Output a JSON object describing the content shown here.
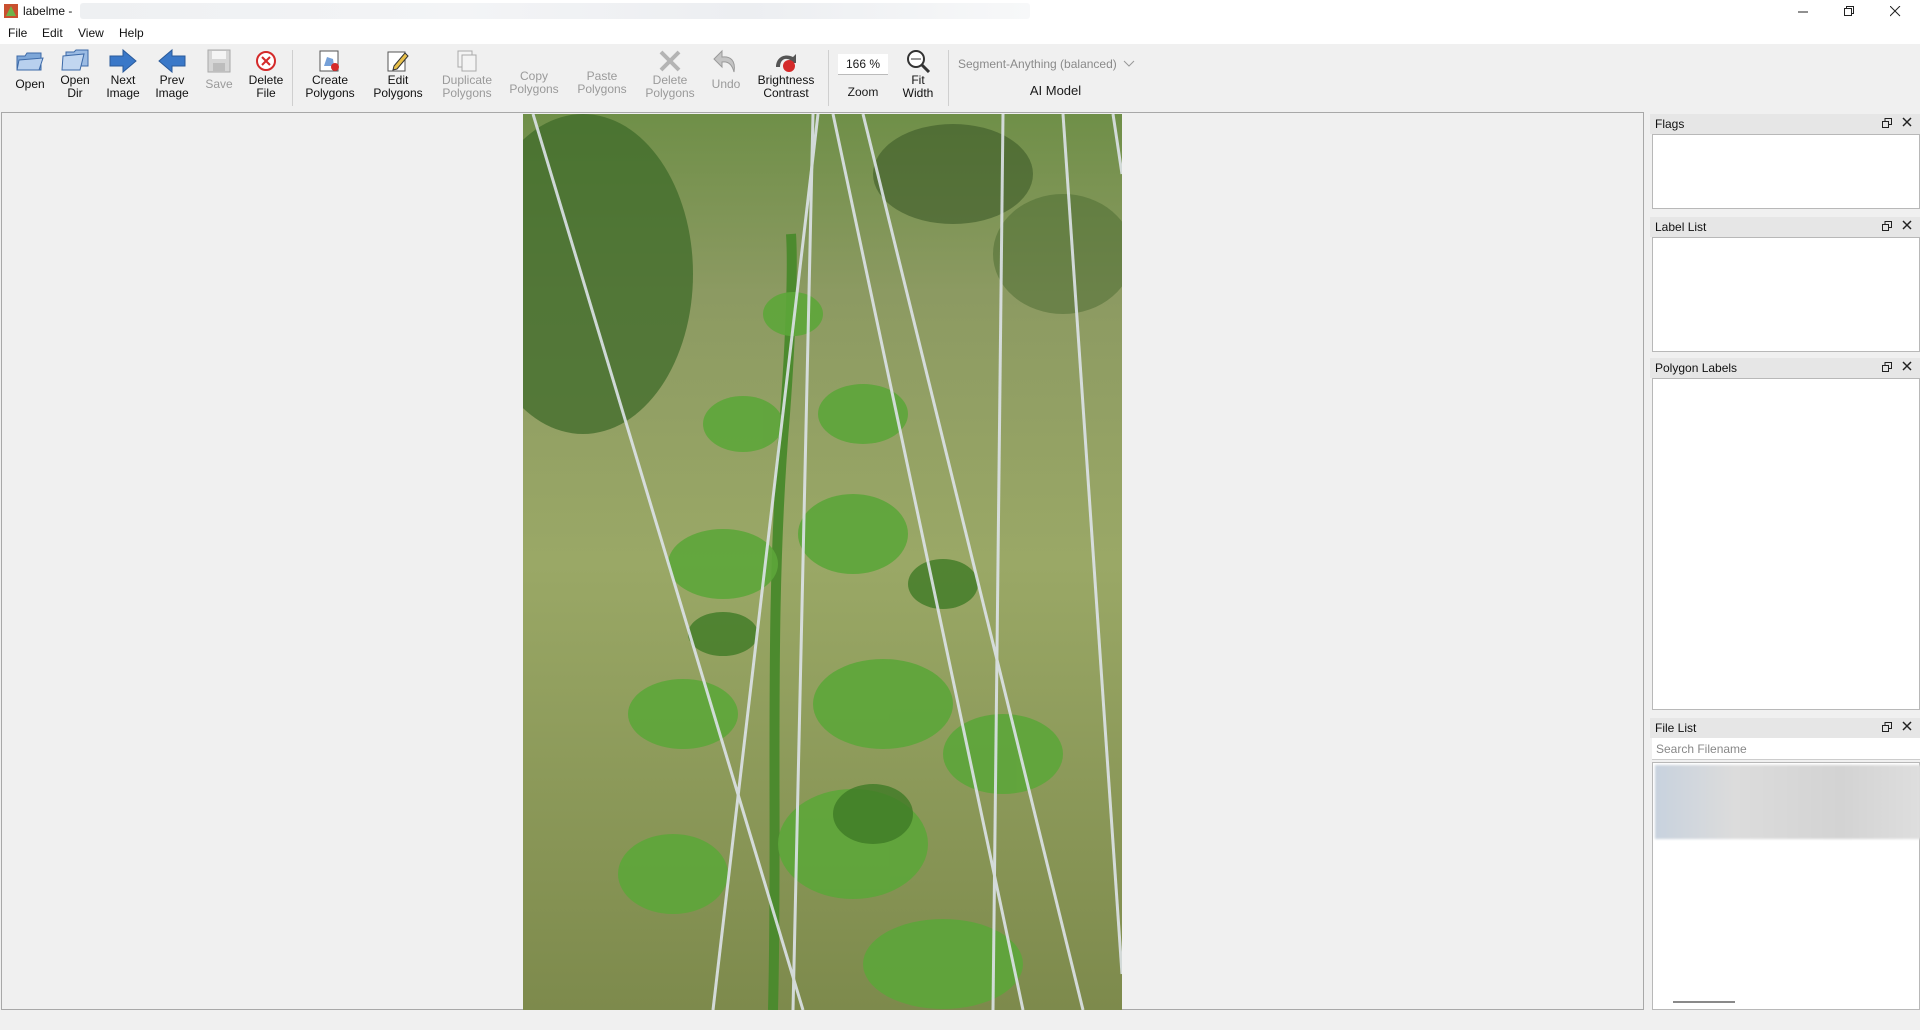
{
  "window": {
    "title": "labelme -",
    "icon": "labelme-icon"
  },
  "menu": [
    "File",
    "Edit",
    "View",
    "Help"
  ],
  "toolbar": {
    "open": "Open",
    "open_dir": "Open\nDir",
    "next_image": "Next\nImage",
    "prev_image": "Prev\nImage",
    "save": "Save",
    "delete_file": "Delete\nFile",
    "create_polygons": "Create\nPolygons",
    "edit_polygons": "Edit\nPolygons",
    "duplicate_polygons": "Duplicate\nPolygons",
    "copy_polygons": "Copy\nPolygons",
    "paste_polygons": "Paste\nPolygons",
    "delete_polygons": "Delete\nPolygons",
    "undo": "Undo",
    "brightness_contrast": "Brightness\nContrast",
    "zoom_value": "166 %",
    "zoom_label": "Zoom",
    "fit_width": "Fit\nWidth",
    "ai_model_value": "Segment-Anything (balanced)",
    "ai_model_label": "AI Model"
  },
  "docks": {
    "flags": "Flags",
    "label_list": "Label List",
    "polygon_labels": "Polygon Labels",
    "file_list": "File List",
    "search_placeholder": "Search Filename"
  },
  "colors": {
    "accent": "#3a78c8",
    "delete_red": "#d42a2a",
    "disabled": "#9a9a9a"
  }
}
